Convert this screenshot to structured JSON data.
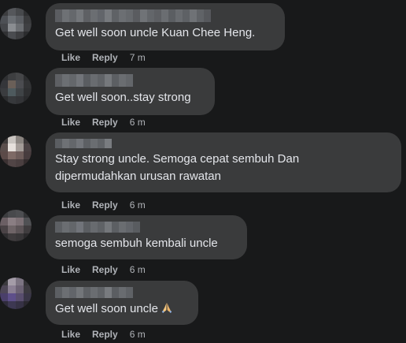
{
  "comments": [
    {
      "text": "Get well soon uncle Kuan Chee Heng.",
      "like": "Like",
      "reply": "Reply",
      "time": "7 m"
    },
    {
      "text": "Get well soon..stay strong",
      "like": "Like",
      "reply": "Reply",
      "time": "6 m"
    },
    {
      "text": "Stay strong uncle. Semoga cepat sembuh Dan\ndipermudahkan urusan rawatan",
      "like": "Like",
      "reply": "Reply",
      "time": "6 m"
    },
    {
      "text": "semoga sembuh kembali uncle",
      "like": "Like",
      "reply": "Reply",
      "time": "6 m"
    },
    {
      "text": "Get well soon uncle",
      "emoji": "folded-hands-emoji",
      "like": "Like",
      "reply": "Reply",
      "time": "6 m"
    }
  ],
  "colors": {
    "background": "#18191a",
    "bubble": "#3a3b3c",
    "text": "#e4e6eb",
    "meta": "#b0b3b8"
  }
}
